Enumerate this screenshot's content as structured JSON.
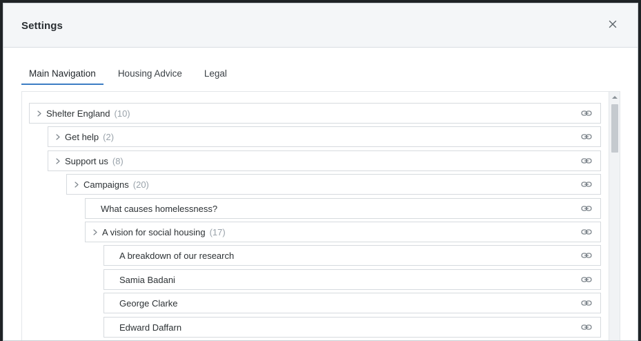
{
  "modal": {
    "title": "Settings",
    "close_icon": "close-icon"
  },
  "tabs": [
    {
      "label": "Main Navigation",
      "active": true
    },
    {
      "label": "Housing Advice",
      "active": false
    },
    {
      "label": "Legal",
      "active": false
    }
  ],
  "tree": {
    "items": [
      {
        "label": "Shelter England",
        "count": "(10)",
        "expandable": true,
        "level": 0
      },
      {
        "label": "Get help",
        "count": "(2)",
        "expandable": true,
        "level": 1
      },
      {
        "label": "Support us",
        "count": "(8)",
        "expandable": true,
        "level": 1
      },
      {
        "label": "Campaigns",
        "count": "(20)",
        "expandable": true,
        "level": 2
      },
      {
        "label": "What causes homelessness?",
        "count": "",
        "expandable": false,
        "level": 3
      },
      {
        "label": "A vision for social housing",
        "count": "(17)",
        "expandable": true,
        "level": 3
      },
      {
        "label": "A breakdown of our research",
        "count": "",
        "expandable": false,
        "level": 4
      },
      {
        "label": "Samia Badani",
        "count": "",
        "expandable": false,
        "level": 4
      },
      {
        "label": "George Clarke",
        "count": "",
        "expandable": false,
        "level": 4
      },
      {
        "label": "Edward Daffarn",
        "count": "",
        "expandable": false,
        "level": 4
      }
    ],
    "link_icon": "link-icon",
    "chevron_icon": "chevron-right-icon"
  },
  "colors": {
    "accent": "#3b7cc4",
    "header_bg": "#f4f6f8",
    "count_text": "#99a2aa",
    "border": "#d6dade"
  }
}
